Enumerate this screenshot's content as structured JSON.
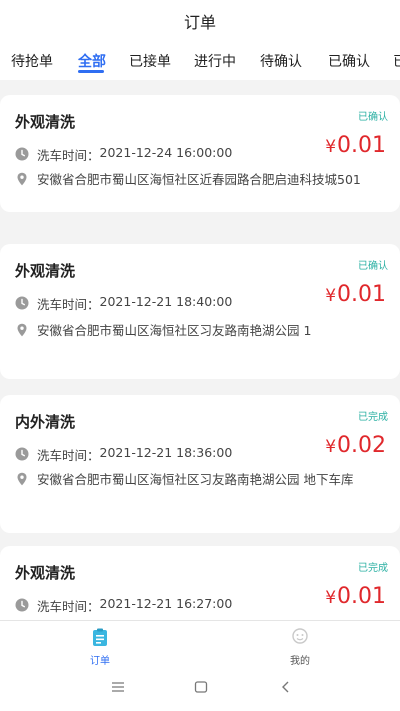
{
  "header": {
    "title": "订单"
  },
  "tabs": [
    {
      "label": "待抢单",
      "active": false
    },
    {
      "label": "全部",
      "active": true
    },
    {
      "label": "已接单",
      "active": false
    },
    {
      "label": "进行中",
      "active": false
    },
    {
      "label": "待确认",
      "active": false
    },
    {
      "label": "已确认",
      "active": false
    },
    {
      "label": "已",
      "active": false
    }
  ],
  "orders": [
    {
      "name": "外观清洗",
      "status": "已确认",
      "time_label": "洗车时间：",
      "time": "2021-12-24 16:00:00",
      "price": "0.01",
      "address": "安徽省合肥市蜀山区海恒社区近春园路合肥启迪科技城501"
    },
    {
      "name": "外观清洗",
      "status": "已确认",
      "time_label": "洗车时间：",
      "time": "2021-12-21 18:40:00",
      "price": "0.01",
      "address": "安徽省合肥市蜀山区海恒社区习友路南艳湖公园 1"
    },
    {
      "name": "内外清洗",
      "status": "已完成",
      "time_label": "洗车时间：",
      "time": "2021-12-21 18:36:00",
      "price": "0.02",
      "address": "安徽省合肥市蜀山区海恒社区习友路南艳湖公园 地下车库"
    },
    {
      "name": "外观清洗",
      "status": "已完成",
      "time_label": "洗车时间：",
      "time": "2021-12-21 16:27:00",
      "price": "0.01",
      "address": ""
    }
  ],
  "currency_symbol": "¥",
  "bottom_nav": [
    {
      "label": "订单",
      "active": true,
      "icon": "clipboard-icon"
    },
    {
      "label": "我的",
      "active": false,
      "icon": "profile-icon"
    }
  ],
  "colors": {
    "accent": "#2f6ef2",
    "price": "#e0282c",
    "status": "#2bb0a3"
  }
}
